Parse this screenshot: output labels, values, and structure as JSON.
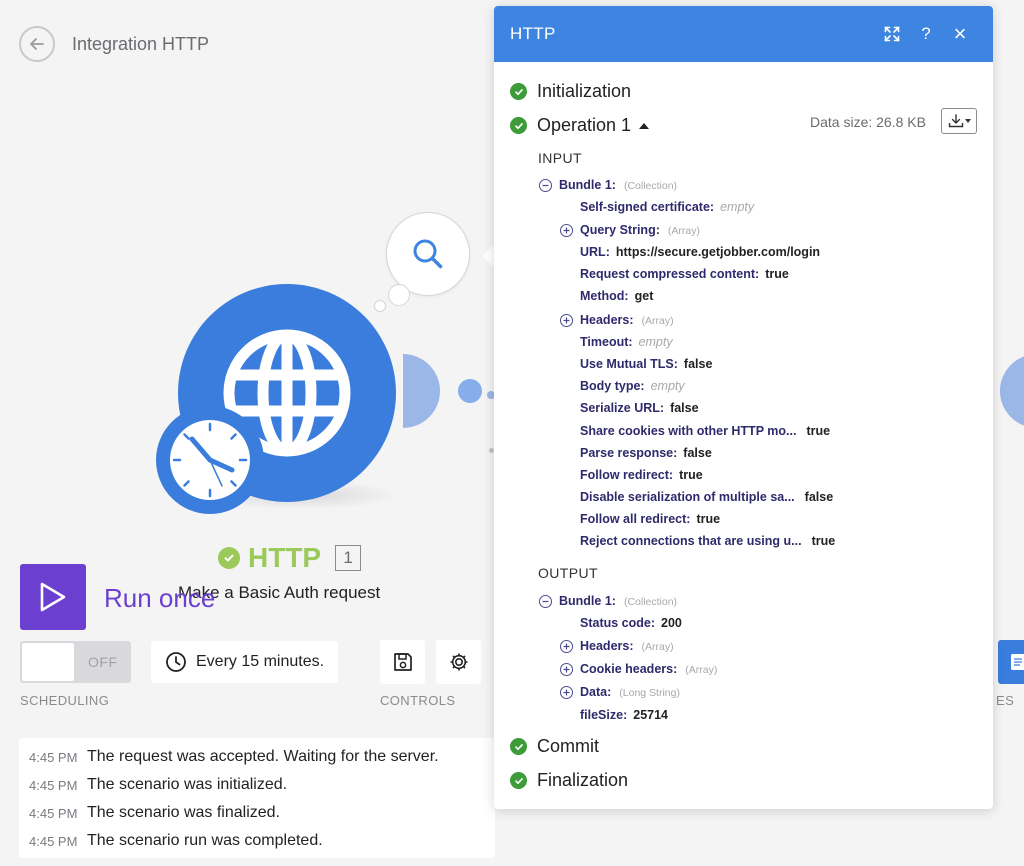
{
  "page": {
    "title": "Integration HTTP"
  },
  "module": {
    "name": "HTTP",
    "number": "1",
    "description": "Make a Basic Auth request"
  },
  "run": {
    "label": "Run once"
  },
  "scheduling": {
    "toggle_state": "OFF",
    "schedule_text": "Every 15 minutes.",
    "section_label": "SCHEDULING"
  },
  "controls": {
    "section_label": "CONTROLS"
  },
  "notes": {
    "section_label_fragment": "ES"
  },
  "log": [
    {
      "time": "4:45 PM",
      "message": "The request was accepted. Waiting for the server."
    },
    {
      "time": "4:45 PM",
      "message": "The scenario was initialized."
    },
    {
      "time": "4:45 PM",
      "message": "The scenario was finalized."
    },
    {
      "time": "4:45 PM",
      "message": "The scenario run was completed."
    }
  ],
  "panel": {
    "title": "HTTP",
    "help_glyph": "?",
    "close_glyph": "×",
    "data_size": "Data size: 26.8 KB",
    "stages": {
      "initialization": "Initialization",
      "operation": "Operation 1",
      "commit": "Commit",
      "finalization": "Finalization"
    },
    "input_label": "INPUT",
    "output_label": "OUTPUT",
    "input_bundle": {
      "label": "Bundle 1:",
      "type": "(Collection)",
      "fields": [
        {
          "key": "Self-signed certificate:",
          "value": "empty"
        },
        {
          "key": "Query String:",
          "type": "(Array)"
        },
        {
          "key": "URL:",
          "value": "https://secure.getjobber.com/login"
        },
        {
          "key": "Request compressed content:",
          "value": "true"
        },
        {
          "key": "Method:",
          "value": "get"
        },
        {
          "key": "Headers:",
          "type": "(Array)"
        },
        {
          "key": "Timeout:",
          "value": "empty"
        },
        {
          "key": "Use Mutual TLS:",
          "value": "false"
        },
        {
          "key": "Body type:",
          "value": "empty"
        },
        {
          "key": "Serialize URL:",
          "value": "false"
        },
        {
          "key": "Share cookies with other HTTP mo...",
          "value": "true"
        },
        {
          "key": "Parse response:",
          "value": "false"
        },
        {
          "key": "Follow redirect:",
          "value": "true"
        },
        {
          "key": "Disable serialization of multiple sa...",
          "value": "false"
        },
        {
          "key": "Follow all redirect:",
          "value": "true"
        },
        {
          "key": "Reject connections that are using u...",
          "value": "true"
        }
      ]
    },
    "output_bundle": {
      "label": "Bundle 1:",
      "type": "(Collection)",
      "fields": [
        {
          "key": "Status code:",
          "value": "200"
        },
        {
          "key": "Headers:",
          "type": "(Array)"
        },
        {
          "key": "Cookie headers:",
          "type": "(Array)"
        },
        {
          "key": "Data:",
          "type": "(Long String)"
        },
        {
          "key": "fileSize:",
          "value": "25714"
        }
      ]
    }
  },
  "colors": {
    "accent_blue": "#3d85e0",
    "run_purple": "#6b3fd0",
    "success_green": "#3e9b3a",
    "module_green": "#9bc95a"
  }
}
